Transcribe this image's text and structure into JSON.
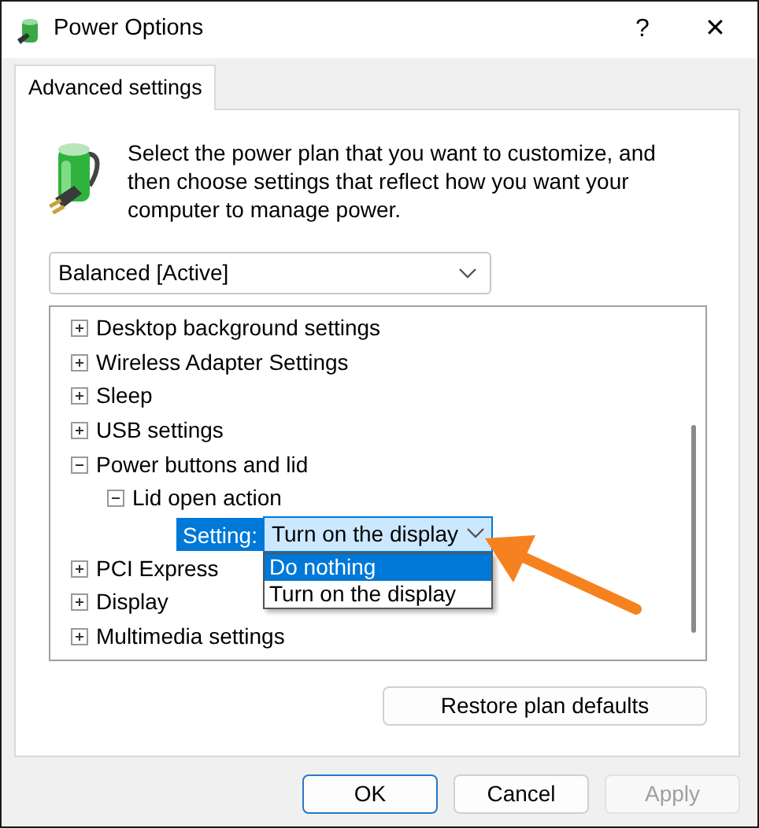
{
  "window": {
    "title": "Power Options",
    "help": "?",
    "close": "✕"
  },
  "tabs": [
    {
      "label": "Advanced settings",
      "selected": true
    }
  ],
  "intro": "Select the power plan that you want to customize, and then choose settings that reflect how you want your computer to manage power.",
  "plan": {
    "value": "Balanced [Active]"
  },
  "tree": [
    {
      "label": "Desktop background settings",
      "expanded": false
    },
    {
      "label": "Wireless Adapter Settings",
      "expanded": false
    },
    {
      "label": "Sleep",
      "expanded": false
    },
    {
      "label": "USB settings",
      "expanded": false
    },
    {
      "label": "Power buttons and lid",
      "expanded": true,
      "children": [
        {
          "label": "Lid open action",
          "expanded": true,
          "setting": {
            "label": "Setting:",
            "value": "Turn on the display",
            "open": true,
            "options": [
              {
                "label": "Do nothing",
                "highlighted": true
              },
              {
                "label": "Turn on the display",
                "highlighted": false
              }
            ]
          }
        }
      ]
    },
    {
      "label": "PCI Express",
      "expanded": false
    },
    {
      "label": "Display",
      "expanded": false
    },
    {
      "label": "Multimedia settings",
      "expanded": false
    }
  ],
  "restore_button": "Restore plan defaults",
  "buttons": [
    {
      "label": "OK",
      "default": true,
      "disabled": false
    },
    {
      "label": "Cancel",
      "default": false,
      "disabled": false
    },
    {
      "label": "Apply",
      "default": false,
      "disabled": true
    }
  ]
}
